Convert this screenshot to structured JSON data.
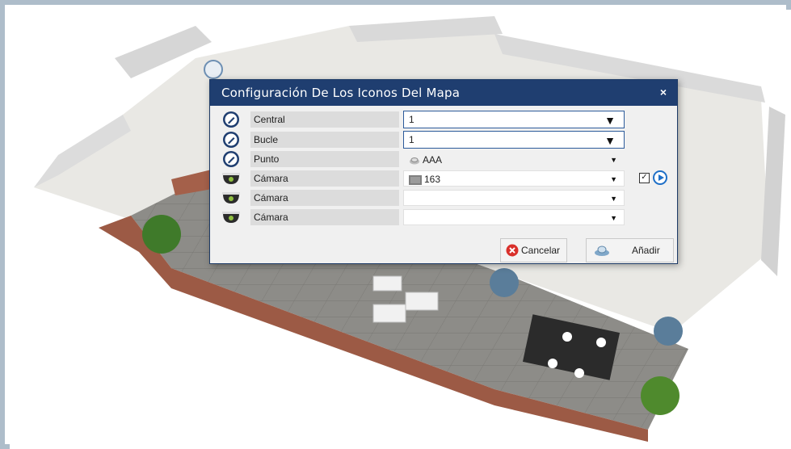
{
  "dialog": {
    "title": "Configuración De Los Iconos Del Mapa",
    "close_glyph": "×",
    "rows": [
      {
        "label": "Central",
        "value": "1",
        "icon": "edit-icon"
      },
      {
        "label": "Bucle",
        "value": "1",
        "icon": "edit-icon"
      },
      {
        "label": "Punto",
        "value": "AAA",
        "icon": "edit-icon",
        "value_icon": "detector-icon"
      },
      {
        "label": "Cámara",
        "value": "163",
        "icon": "dome-camera-icon",
        "value_icon": "camera-thumbnail-icon",
        "checked": true
      },
      {
        "label": "Cámara",
        "value": "",
        "icon": "dome-camera-icon"
      },
      {
        "label": "Cámara",
        "value": "",
        "icon": "dome-camera-icon"
      }
    ],
    "check_mark": "✓",
    "buttons": {
      "cancel": "Cancelar",
      "add": "Añadir"
    }
  },
  "colors": {
    "titlebar": "#1f3e70",
    "accent": "#1e6fc7",
    "cancel_red": "#d9302b"
  }
}
